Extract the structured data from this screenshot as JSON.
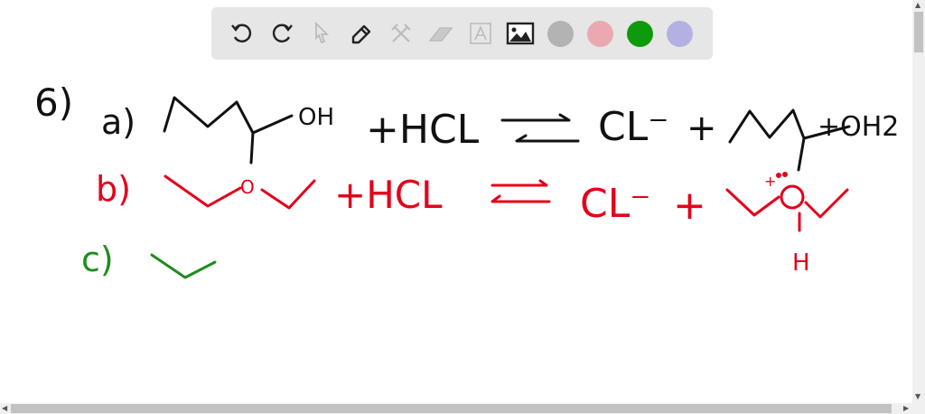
{
  "toolbar": {
    "tools": [
      "undo-icon",
      "redo-icon",
      "select-icon",
      "pen-icon",
      "tools-icon",
      "eraser-icon",
      "text-icon",
      "image-icon"
    ],
    "colors": [
      "#b3b3b3",
      "#e8a9b1",
      "#0d9a0d",
      "#b3b0e3"
    ]
  },
  "ink": {
    "black": "#111111",
    "red": "#e3001b",
    "green": "#1f8c1f"
  },
  "board": {
    "problem_label": "6)",
    "a": {
      "label": "a)",
      "oh": "OH",
      "plus_hcl": "+HCL",
      "cl": "CL⁻",
      "plus": "+",
      "oh2": "+OH2"
    },
    "b": {
      "label": "b)",
      "o": "O",
      "plus_hcl": "+HCL",
      "cl": "CL⁻",
      "plus": "+",
      "oplus": "+",
      "h": "H"
    },
    "c": {
      "label": "c)"
    }
  }
}
